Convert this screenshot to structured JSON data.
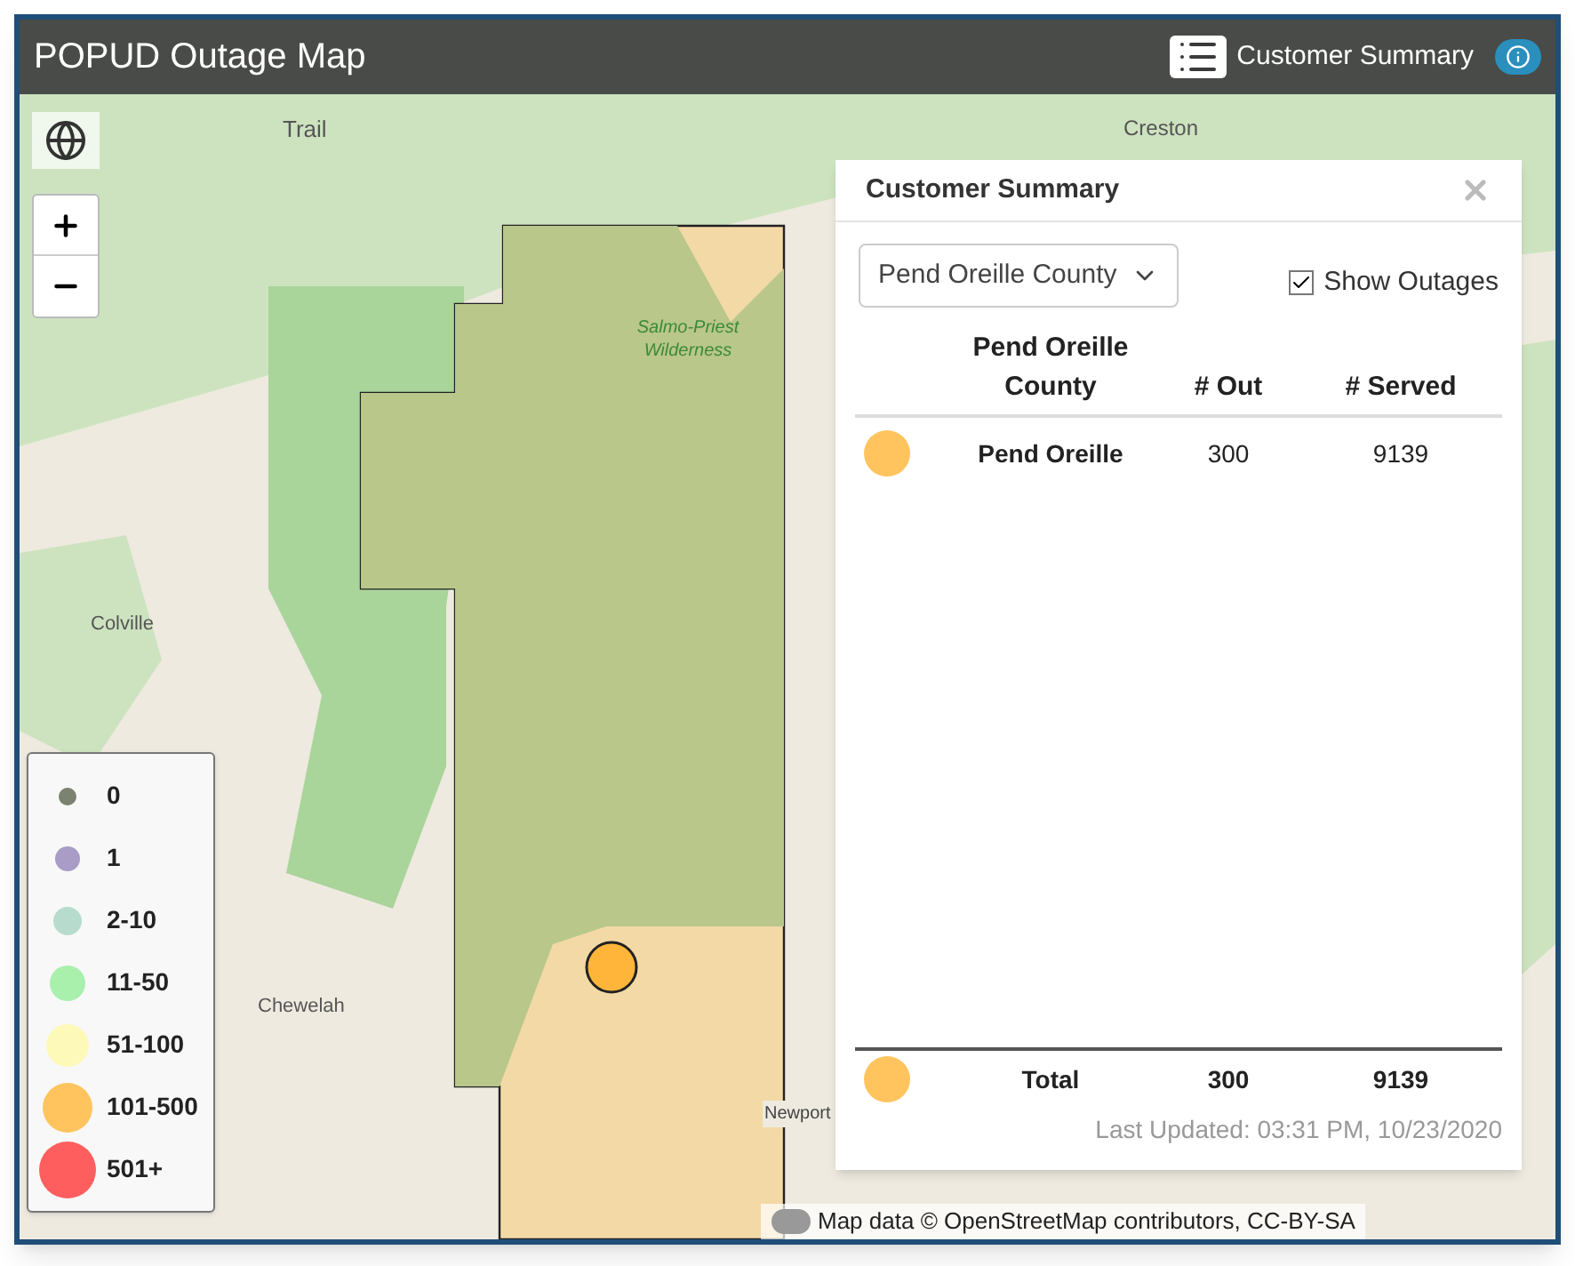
{
  "header": {
    "title": "POPUD Outage Map",
    "summary_button": "Customer Summary"
  },
  "map": {
    "labels": [
      {
        "text": "Trail"
      },
      {
        "text": "Creston"
      },
      {
        "text": "Salmo-Priest Wilderness"
      },
      {
        "text": "Colville"
      },
      {
        "text": "Chewelah"
      },
      {
        "text": "Newport"
      }
    ],
    "outages": [
      {
        "color": "#ffb53a"
      }
    ],
    "attribution": "Map data © OpenStreetMap contributors, CC-BY-SA"
  },
  "legend": [
    {
      "label": "0",
      "color": "#7a8270"
    },
    {
      "label": "1",
      "color": "#a99cc6"
    },
    {
      "label": "2-10",
      "color": "#b7dccd"
    },
    {
      "label": "11-50",
      "color": "#a8f0ac"
    },
    {
      "label": "51-100",
      "color": "#fdf9b8"
    },
    {
      "label": "101-500",
      "color": "#ffc45e"
    },
    {
      "label": "501+",
      "color": "#ff5e5e"
    }
  ],
  "summary": {
    "title": "Customer Summary",
    "region": "Pend Oreille County",
    "show_outages": {
      "label": "Show Outages",
      "checked": true
    },
    "columns": [
      "Pend Oreille County",
      "# Out",
      "# Served"
    ],
    "rows": [
      {
        "name": "Pend Oreille",
        "out": "300",
        "served": "9139",
        "color": "#ffc45e"
      }
    ],
    "total": {
      "label": "Total",
      "out": "300",
      "served": "9139",
      "color": "#ffc45e"
    },
    "last_updated": "Last Updated: 03:31 PM, 10/23/2020"
  }
}
